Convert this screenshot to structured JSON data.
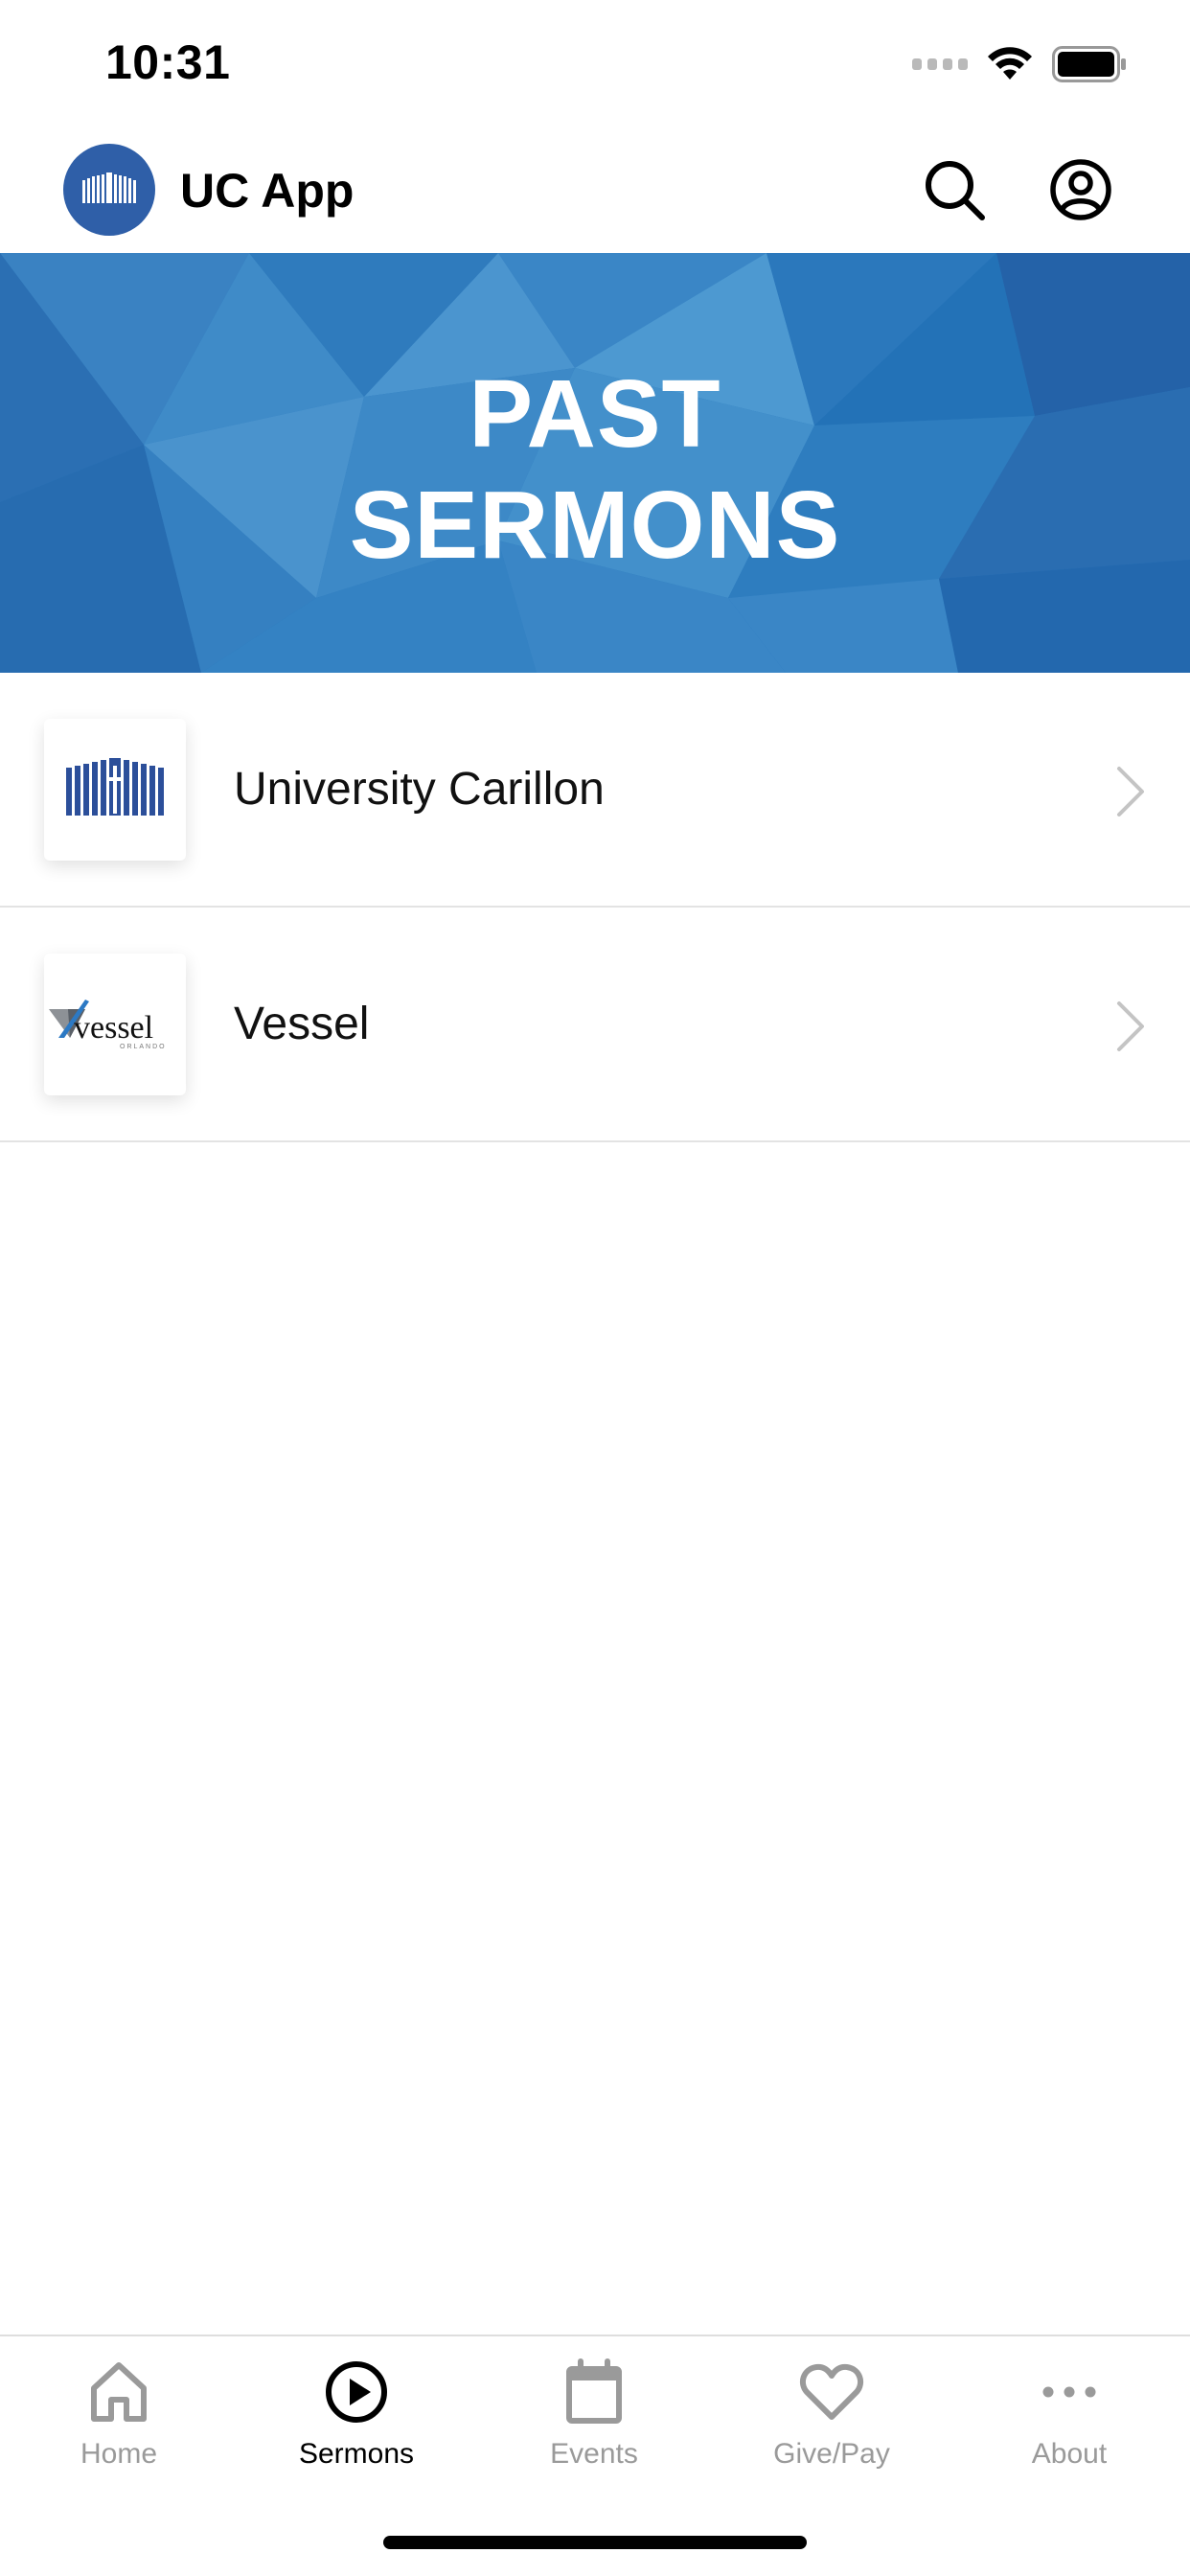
{
  "status_bar": {
    "time": "10:31"
  },
  "header": {
    "title": "UC App"
  },
  "banner": {
    "line1": "PAST",
    "line2": "SERMONS"
  },
  "sermons": [
    {
      "label": "University Carillon"
    },
    {
      "label": "Vessel",
      "thumb_text": "vessel",
      "thumb_subtext": "ORLANDO"
    }
  ],
  "tabs": [
    {
      "label": "Home",
      "icon": "home-icon",
      "active": false
    },
    {
      "label": "Sermons",
      "icon": "play-circle-icon",
      "active": true
    },
    {
      "label": "Events",
      "icon": "calendar-icon",
      "active": false
    },
    {
      "label": "Give/Pay",
      "icon": "heart-icon",
      "active": false
    },
    {
      "label": "About",
      "icon": "more-icon",
      "active": false
    }
  ],
  "colors": {
    "brand_blue": "#2f5fa8",
    "banner_blue": "#2a78bd",
    "inactive_gray": "#9a9a9a"
  }
}
